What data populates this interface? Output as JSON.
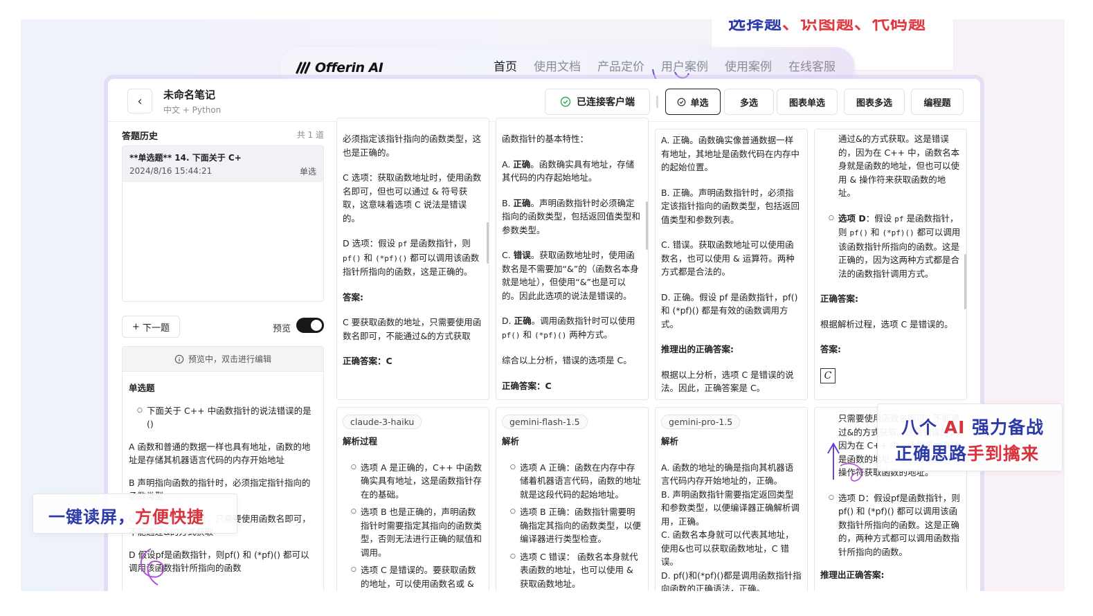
{
  "colors": {
    "accent_blue": "#2b3aa8",
    "accent_red": "#d8323c",
    "connected_green": "#2fa84f"
  },
  "nav": {
    "logo_text": "Offerin AI",
    "items": [
      "首页",
      "使用文档",
      "产品定价",
      "用户案例",
      "使用案例",
      "在线客服"
    ],
    "active_index": 0
  },
  "promo_top": {
    "text_a": "选择题",
    "text_b": "、识图题、代码题"
  },
  "topbar": {
    "title": "未命名笔记",
    "subtitle": "中文 + Python",
    "connection_status": "已连接客户端",
    "question_types": [
      "单选",
      "多选",
      "图表单选",
      "图表多选",
      "编程题"
    ],
    "active_type": "单选"
  },
  "history": {
    "title": "答题历史",
    "count": "共 1 道",
    "items": [
      {
        "title": "**单选题** 14. 下面关于 C+",
        "date": "2024/8/16 15:44:21",
        "type": "单选"
      }
    ]
  },
  "controls": {
    "next_label": "下一题",
    "preview_label": "预览",
    "preview_on": true
  },
  "preview": {
    "hint": "预览中，双击进行编辑",
    "heading": "单选题",
    "question": "下面关于 C++ 中函数指针的说法错误的是 ()",
    "option_a": "A 函数和普通的数据一样也具有地址，函数的地址是存储其机器语言代码的内存开始地址",
    "option_b": "B 声明指向函数的指针时，必须指定指针指向的函数类型",
    "option_c": "C 要获取函数的地址，只需要使用函数名即可，不能通过&的方式获取",
    "option_d": "D 假设pf是函数指针，则pf() 和 (*pf)() 都可以调用该函数指针所指向的函数"
  },
  "cards_top": {
    "c1": {
      "p1": "必须指定该指针指向的函数类型，这也是正确的。",
      "p2": "C 选项：获取函数地址时，使用函数名即可，但也可以通过 & 符号获取，这意味着选项 C 说法是错误的。",
      "p3_a": "D 选项：假设 ",
      "p3_code1": "pf",
      "p3_b": " 是函数指针，则 ",
      "p3_code2": "pf()",
      "p3_c": " 和 ",
      "p3_code3": "(*pf)()",
      "p3_d": " 都可以调用该函数指针所指向的函数，这是正确的。",
      "answer_label": "答案:",
      "answer_text": "C 要获取函数的地址，只需要使用函数名即可，不能通过&的方式获取",
      "final_label": "正确答案：",
      "final_value": "C"
    },
    "c2": {
      "p0": "函数指针的基本特性：",
      "a_bold": "正确",
      "a_text": "。函数确实具有地址，存储其代码的内存起始地址。",
      "b_bold": "正确",
      "b_text": "。声明函数指针时必须确定指向的函数类型，包括返回值类型和参数类型。",
      "c_bold": "错误",
      "c_text": "。获取函数地址时，使用函数名是不需要加“&”的（函数名本身就是地址），但使用“&”也是可以的。因此此选项的说法是错误的。",
      "d_bold": "正确",
      "d_text1": "。调用函数指针时可以使用 ",
      "d_code1": "pf()",
      "d_text2": " 和 ",
      "d_code2": "(*pf)()",
      "d_text3": " 两种方式。",
      "summary": "综合以上分析，错误的选项是 C。",
      "final_label": "正确答案：",
      "final_value": "C"
    },
    "c3": {
      "p1": "A. 正确。函数确实像普通数据一样有地址，其地址是函数代码在内存中的起始位置。",
      "p2": "B. 正确。声明函数指针时，必须指定该指针指向的函数类型，包括返回值类型和参数列表。",
      "p3": "C. 错误。获取函数地址可以使用函数名，也可以使用 & 运算符。两种方式都是合法的。",
      "p4": "D. 正确。假设 pf 是函数指针，pf() 和 (*pf)() 都是有效的函数调用方式。",
      "derived_label": "推理出的正确答案:",
      "derived_text": "根据以上分析，选项 C 是错误的说法。因此，正确答案是 C。"
    },
    "c4": {
      "p0": "通过&的方式获取。这是错误的，因为在 C++ 中，函数名本身就是函数的地址，但也可以使用 & 操作符来获取函数的地址。",
      "d_bold": "选项 D",
      "d_text1": "：假设 ",
      "d_code1": "pf",
      "d_text2": " 是函数指针，则 ",
      "d_code2": "pf()",
      "d_text3": " 和 ",
      "d_code3": "(*pf)()",
      "d_text4": " 都可以调用该函数指针所指向的函数。这是正确的，因为这两种方式都是合法的函数指针调用方式。",
      "correct_label": "正确答案:",
      "correct_text": "根据解析过程，选项 C 是错误的。",
      "answer_label": "答案:",
      "answer_math": "C"
    }
  },
  "cards_bottom": {
    "b1": {
      "model": "claude-3-haiku",
      "heading": "解析过程",
      "li1": "选项 A 是正确的，C++ 中函数确实具有地址，这是函数指针存在的基础。",
      "li2": "选项 B 也是正确的，声明函数指针时需要指定其指向的函数类型，否则无法进行正确的赋值和调用。",
      "li3": "选项 C 是错误的。要获取函数的地址，可以使用函数名或 & 符号。"
    },
    "b2": {
      "model": "gemini-flash-1.5",
      "heading": "解析",
      "li1": "选项 A 正确：函数在内存中存储着机器语言代码，函数的地址就是这段代码的起始地址。",
      "li2": "选项 B 正确：函数指针需要明确指定其指向的函数类型，以便编译器进行类型检查。",
      "li3": "选项 C 错误： 函数名本身就代表函数的地址，也可以使用 & 获取函数地址。"
    },
    "b3": {
      "model": "gemini-pro-1.5",
      "heading": "解析",
      "p1": "A. 函数的地址的确是指向其机器语言代码内存开始地址的，正确。",
      "p2": "B. 声明函数指针需要指定返回类型和参数类型，以便编译器正确解析调用，正确。",
      "p3": "C. 函数名本身就可以代表其地址，使用&也可以获取函数地址，C 错误。",
      "p4": "D. pf()和(*pf)()都是调用函数指针指向函数的正确语法，正确。"
    },
    "b4": {
      "p0": "只需要使用函数名即可，不能通过&的方式获取。这是错误的，因为在 C++ 中，函数名本身就是函数的地址，但也可以通过 & 操作符获取函数的地址。",
      "li1": "选项 D：假设pf是函数指针，则pf() 和 (*pf)() 都可以调用该函数指针所指向的函数。这是正确的，两种方式都可以调用函数指针所指向的函数。",
      "derived_label": "推理出正确答案:"
    }
  },
  "promo_left": {
    "part_a": "一键读屏，",
    "part_b": "方便快捷"
  },
  "promo_right": {
    "l1_a": "八个 ",
    "l1_b": "AI",
    "l1_c": " 强力备战",
    "l2_a": "正确思路",
    "l2_b": "手到擒来"
  }
}
